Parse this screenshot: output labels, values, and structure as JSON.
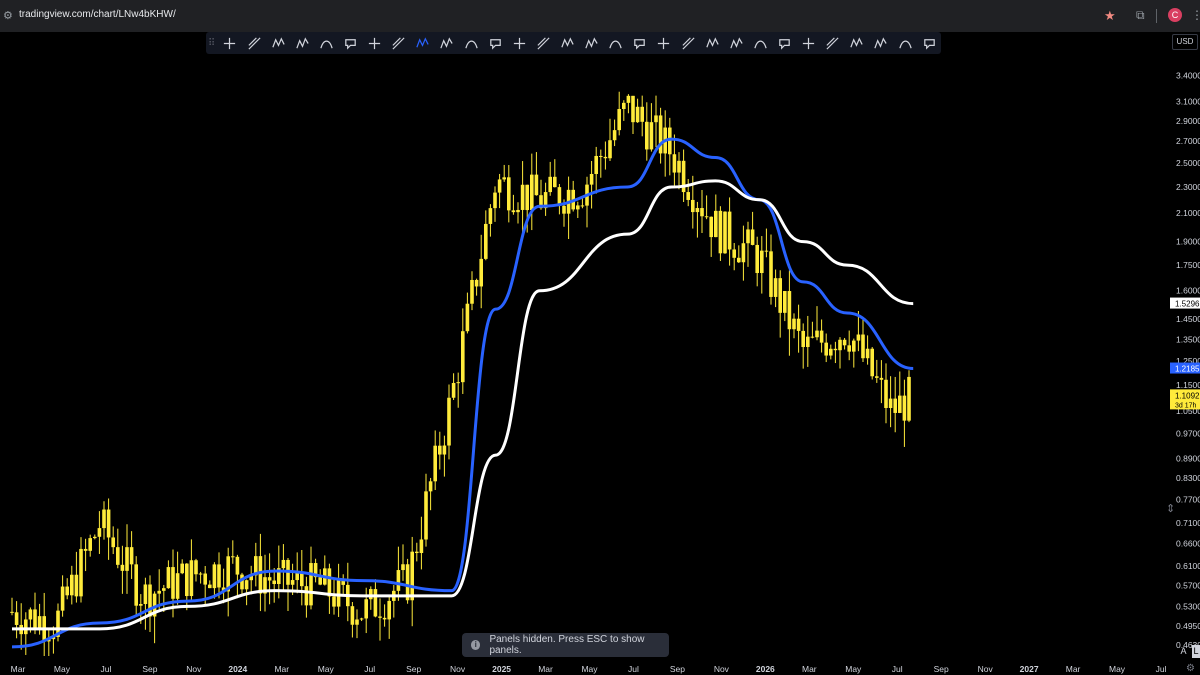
{
  "browser": {
    "url": "tradingview.com/chart/LNw4bKHW/",
    "profile_initial": "C",
    "icons": [
      "site-settings-icon",
      "bookmark-star-icon",
      "extensions-icon",
      "profile-avatar",
      "menu-icon"
    ]
  },
  "toolbar": {
    "tools": [
      "crosshair-icon",
      "pitchfork-icon",
      "abcd-pattern-icon",
      "elliott-wave-icon",
      "curve-icon",
      "callout-icon",
      "anchored-vwap-icon",
      "ellipse-icon",
      "polyline-icon",
      "bars-pattern-icon",
      "volume-profile-icon",
      "rectangle-icon",
      "info-line-icon",
      "vertical-line-icon",
      "fib-channel-icon",
      "date-range-icon",
      "pattern-icon",
      "fib-retracement-icon",
      "brush-icon",
      "path-icon",
      "trend-line-icon",
      "circle-icon",
      "arrow-up-icon",
      "arrow-down-icon",
      "text-list-icon",
      "text-icon",
      "measure-icon",
      "angle-icon",
      "ray-icon",
      "hide-icon"
    ]
  },
  "price_axis": {
    "currency": "USD",
    "ticks": [
      "3.4000",
      "3.1000",
      "2.9000",
      "2.7000",
      "2.5000",
      "2.3000",
      "2.1000",
      "1.9000",
      "1.7500",
      "1.6000",
      "1.4500",
      "1.3500",
      "1.2500",
      "1.1500",
      "1.0500",
      "0.9700",
      "0.8900",
      "0.8300",
      "0.7700",
      "0.7100",
      "0.6600",
      "0.6100",
      "0.5700",
      "0.5300",
      "0.4950",
      "0.4630"
    ],
    "badges": [
      {
        "label": "1.5296",
        "value": 1.5296,
        "bg": "#ffffff",
        "fg": "#000000"
      },
      {
        "label": "1.2185",
        "value": 1.2185,
        "bg": "#2962ff",
        "fg": "#ffffff"
      },
      {
        "label": "1.1092",
        "sub": "3d 17h",
        "value": 1.1092,
        "bg": "#ffeb3b",
        "fg": "#000000"
      }
    ]
  },
  "time_axis": {
    "labels": [
      "Mar",
      "May",
      "Jul",
      "Sep",
      "Nov",
      "2024",
      "Mar",
      "May",
      "Jul",
      "Sep",
      "Nov",
      "2025",
      "Mar",
      "May",
      "Jul",
      "Sep",
      "Nov",
      "2026",
      "Mar",
      "May",
      "Jul",
      "Sep",
      "Nov",
      "2027",
      "Mar",
      "May",
      "Jul"
    ],
    "bold": [
      "2024",
      "2025",
      "2026",
      "2027"
    ]
  },
  "toast": {
    "text": "Panels hidden. Press ESC to show panels."
  },
  "controls": {
    "auto_label": "A",
    "log_label": "L"
  },
  "colors": {
    "candle": "#ffeb3b",
    "ma_fast": "#2962ff",
    "ma_slow": "#ffffff",
    "background": "#000000"
  },
  "chart_data": {
    "type": "candlestick",
    "scale": "log",
    "ylim": [
      0.455,
      3.55
    ],
    "series": [
      {
        "name": "",
        "kind": "ohlc",
        "color": "#ffeb3b",
        "x": [
          "2023-03",
          "2023-05",
          "2023-07",
          "2023-09",
          "2023-11",
          "2024-01",
          "2024-03",
          "2024-05",
          "2024-07",
          "2024-09",
          "2024-11",
          "2025-01",
          "2025-03",
          "2025-05",
          "2025-07",
          "2025-09",
          "2025-11",
          "2026-01",
          "2026-03",
          "2026-05",
          "2026-07",
          "2026-08"
        ],
        "close": [
          0.52,
          0.5,
          0.71,
          0.55,
          0.59,
          0.61,
          0.58,
          0.57,
          0.52,
          0.58,
          1.1,
          2.35,
          2.2,
          2.3,
          3.05,
          2.6,
          2.0,
          1.8,
          1.3,
          1.4,
          1.05,
          1.11
        ]
      },
      {
        "name": "",
        "kind": "ma",
        "color": "#2962ff",
        "x": [
          "2023-03",
          "2023-07",
          "2023-11",
          "2024-03",
          "2024-07",
          "2024-11",
          "2025-01",
          "2025-03",
          "2025-07",
          "2025-09",
          "2025-11",
          "2026-01",
          "2026-03",
          "2026-05",
          "2026-08"
        ],
        "values": [
          0.46,
          0.5,
          0.54,
          0.6,
          0.58,
          0.56,
          1.5,
          2.15,
          2.3,
          2.72,
          2.55,
          2.2,
          1.65,
          1.48,
          1.2185
        ]
      },
      {
        "name": "",
        "kind": "ma",
        "color": "#ffffff",
        "x": [
          "2023-03",
          "2023-07",
          "2023-11",
          "2024-03",
          "2024-07",
          "2024-11",
          "2025-01",
          "2025-03",
          "2025-07",
          "2025-09",
          "2025-11",
          "2026-01",
          "2026-03",
          "2026-05",
          "2026-08"
        ],
        "values": [
          0.49,
          0.49,
          0.53,
          0.56,
          0.55,
          0.55,
          0.9,
          1.6,
          1.95,
          2.3,
          2.35,
          2.2,
          1.9,
          1.75,
          1.5296
        ]
      }
    ]
  }
}
